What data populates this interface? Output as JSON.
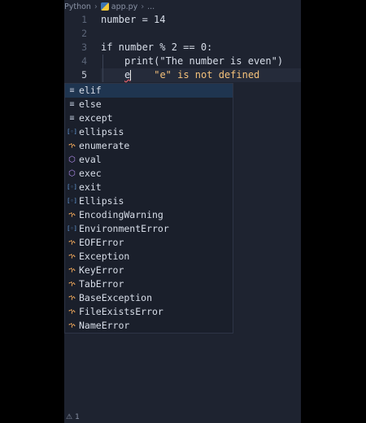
{
  "breadcrumb": {
    "folder": "Python",
    "file": "app.py",
    "more": "..."
  },
  "line_numbers": [
    "1",
    "2",
    "3",
    "4",
    "5"
  ],
  "code": {
    "line1": "number = 14",
    "line2": "",
    "line3": "if number % 2 == 0:",
    "line4": "print(\"The number is even\")",
    "line5_typed": "e",
    "line5_error": "\"e\" is not defined"
  },
  "suggestions": [
    {
      "label": "elif",
      "icon": "keyword-icon"
    },
    {
      "label": "else",
      "icon": "keyword-icon"
    },
    {
      "label": "except",
      "icon": "keyword-icon"
    },
    {
      "label": "ellipsis",
      "icon": "variable-icon"
    },
    {
      "label": "enumerate",
      "icon": "class-icon"
    },
    {
      "label": "eval",
      "icon": "function-icon"
    },
    {
      "label": "exec",
      "icon": "function-icon"
    },
    {
      "label": "exit",
      "icon": "variable-icon"
    },
    {
      "label": "Ellipsis",
      "icon": "variable-icon"
    },
    {
      "label": "EncodingWarning",
      "icon": "class-icon"
    },
    {
      "label": "EnvironmentError",
      "icon": "variable-icon"
    },
    {
      "label": "EOFError",
      "icon": "class-icon"
    },
    {
      "label": "Exception",
      "icon": "class-icon"
    },
    {
      "label": "KeyError",
      "icon": "class-icon"
    },
    {
      "label": "TabError",
      "icon": "class-icon"
    },
    {
      "label": "BaseException",
      "icon": "class-icon"
    },
    {
      "label": "FileExistsError",
      "icon": "class-icon"
    },
    {
      "label": "NameError",
      "icon": "class-icon"
    }
  ],
  "status": {
    "problems_count": "1"
  }
}
